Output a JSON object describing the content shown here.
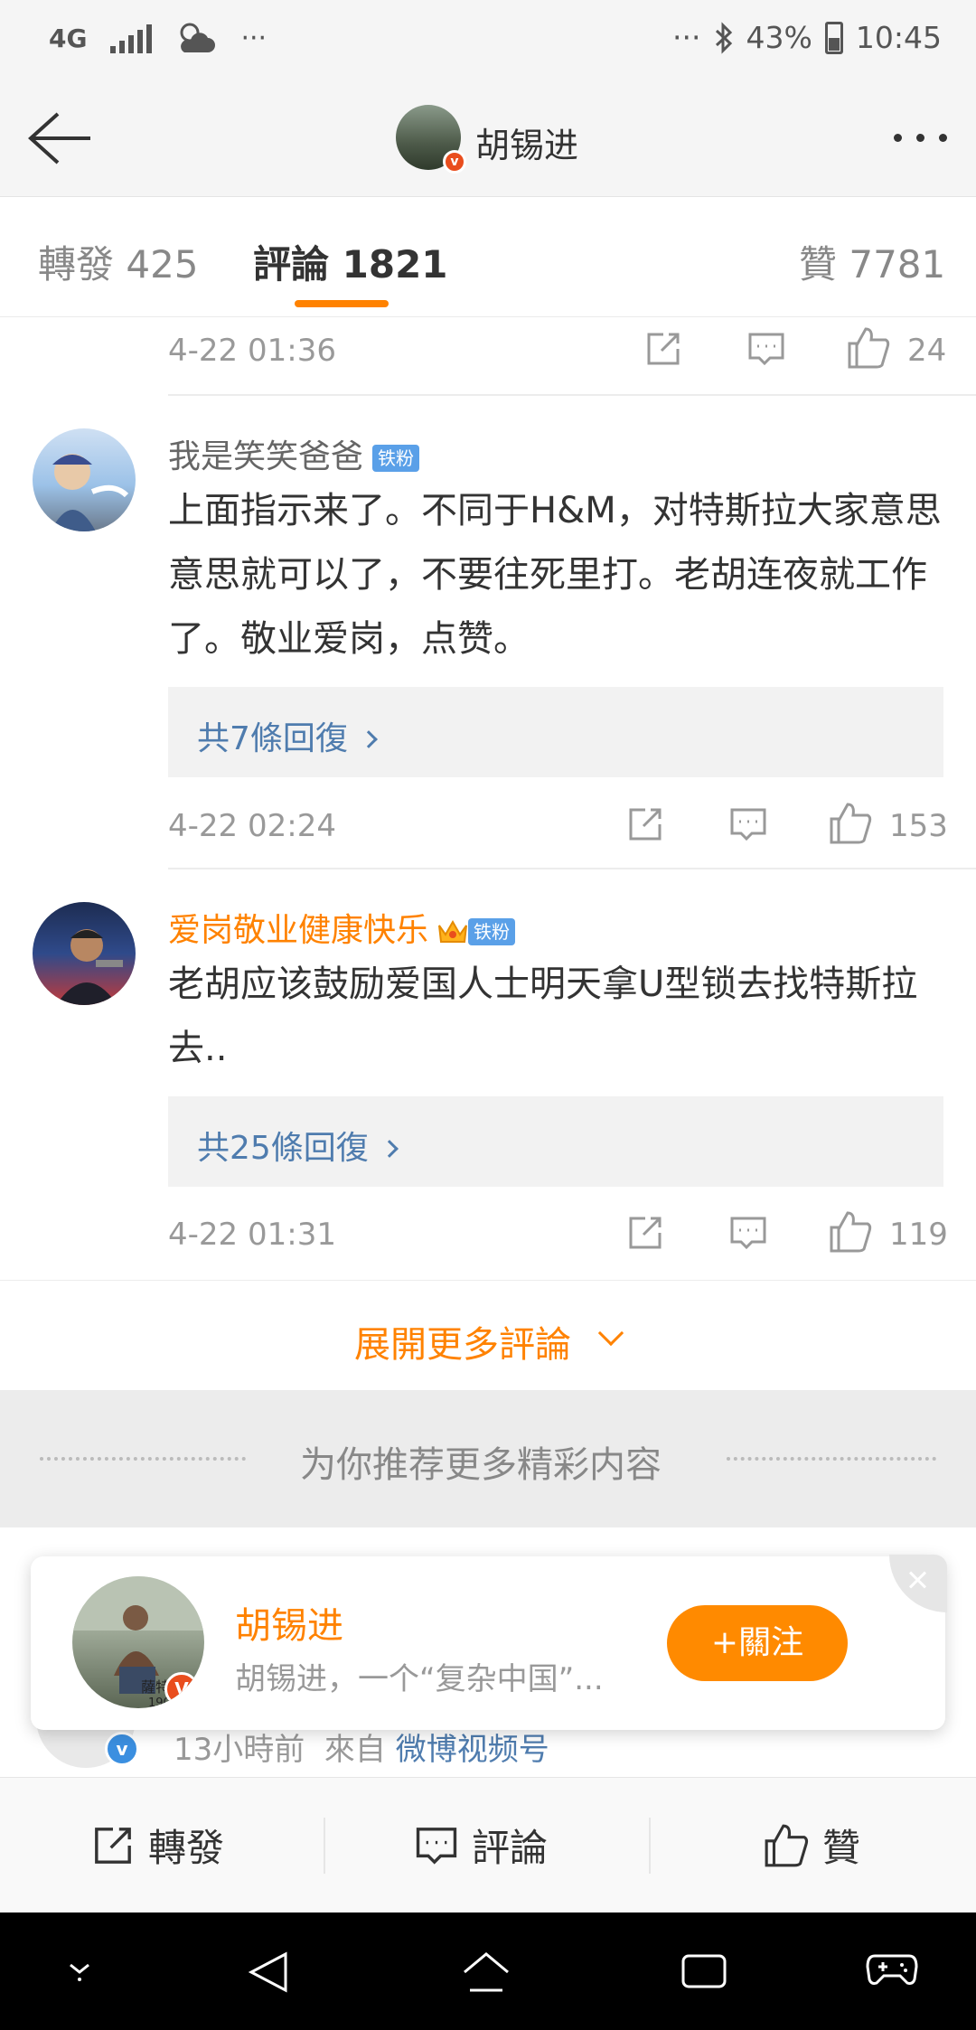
{
  "status_bar": {
    "network": "4G",
    "dots_left": "···",
    "dots_right": "···",
    "battery": "43%",
    "time": "10:45"
  },
  "nav": {
    "title": "胡锡进"
  },
  "tabs": [
    {
      "label": "轉發 425"
    },
    {
      "label": "評論 1821"
    },
    {
      "label": "贊 7781"
    }
  ],
  "top_row": {
    "time": "4-22 01:36",
    "likes": "24"
  },
  "comments": [
    {
      "user": "我是笑笑爸爸",
      "badge": "铁粉",
      "text": "上面指示来了。不同于H&M，对特斯拉大家意思意思就可以了，不要往死里打。老胡连夜就工作了。敬业爱岗，点赞。",
      "replies": "共7條回復",
      "time": "4-22 02:24",
      "likes": "153"
    },
    {
      "user": "爱岗敬业健康快乐",
      "badge": "铁粉",
      "text": "老胡应该鼓励爱国人士明天拿U型锁去找特斯拉去..",
      "replies": "共25條回復",
      "time": "4-22 01:31",
      "likes": "119"
    }
  ],
  "expand": {
    "label": "展開更多評論"
  },
  "recommend": {
    "label": "为你推荐更多精彩内容"
  },
  "behind_post": {
    "time": "13小時前",
    "from": "來自",
    "source": "微博视频号"
  },
  "follow_card": {
    "name": "胡锡进",
    "desc": "胡锡进，一个“复杂中国”...",
    "button": "+關注",
    "avatar_text": "薩特 190"
  },
  "bottom_bar": {
    "repost": "轉發",
    "comment": "評論",
    "like": "贊"
  },
  "colors": {
    "accent": "#ff8200",
    "link": "#4f7cae",
    "fan_badge": "#5aa0e8"
  }
}
